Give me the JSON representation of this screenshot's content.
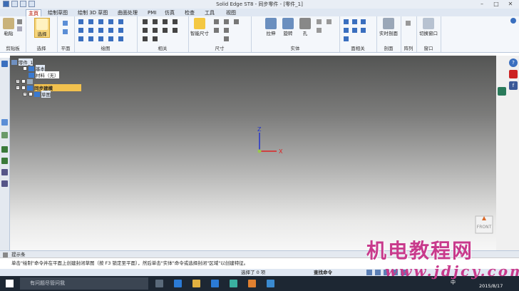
{
  "window": {
    "title": "Solid Edge ST8 - 同步零件 - [零件_1]"
  },
  "tabs": [
    {
      "label": "主页"
    },
    {
      "label": "绘制草图"
    },
    {
      "label": "绘制 3D 草图"
    },
    {
      "label": "曲面处理"
    },
    {
      "label": "PMI"
    },
    {
      "label": "仿真"
    },
    {
      "label": "检查"
    },
    {
      "label": "工具"
    },
    {
      "label": "视图"
    }
  ],
  "ribbon": {
    "paste_label": "粘贴",
    "select_label": "选择",
    "smart_dimension_label": "智能尺寸",
    "extrude_label": "拉伸",
    "revolve_label": "旋转",
    "hole_label": "孔",
    "live_section_label": "实时剖面",
    "switch_window_label": "切换窗口",
    "groups": [
      "剪贴板",
      "选择",
      "平面",
      "绘图",
      "相关",
      "尺寸",
      "实体",
      "面相关",
      "剖面",
      "阵列",
      "窗口"
    ]
  },
  "pathfinder": {
    "items": [
      {
        "label": "零件_1"
      },
      {
        "label": "基本"
      },
      {
        "label": "材料（无）"
      },
      {
        "label": "基本参考平面"
      },
      {
        "label": "同步建模"
      },
      {
        "label": "草图"
      }
    ]
  },
  "viewport": {
    "axis_z": "Z",
    "axis_x": "X",
    "view_cube_label": "FRONT"
  },
  "prompt": {
    "title": "提示条",
    "hint": "单击\"绘制\"命令并在平面上创建封闭草图（按 F3 锁定至平面），然后单击\"实体\"命令或选择封闭\"区域\"以创建特征。"
  },
  "statusbar": {
    "selection": "选择了 0 项",
    "find_command": "查找命令"
  },
  "taskbar": {
    "search_placeholder": "有问题尽管问我",
    "date": "2015/8/17",
    "ime": "中"
  },
  "watermark": {
    "line1": "机电教程网",
    "line2": "www.jdjcy.com"
  },
  "colors": {
    "accent_red": "#c0392b",
    "sync_highlight": "#f2c14e",
    "watermark": "#c83a8c"
  }
}
